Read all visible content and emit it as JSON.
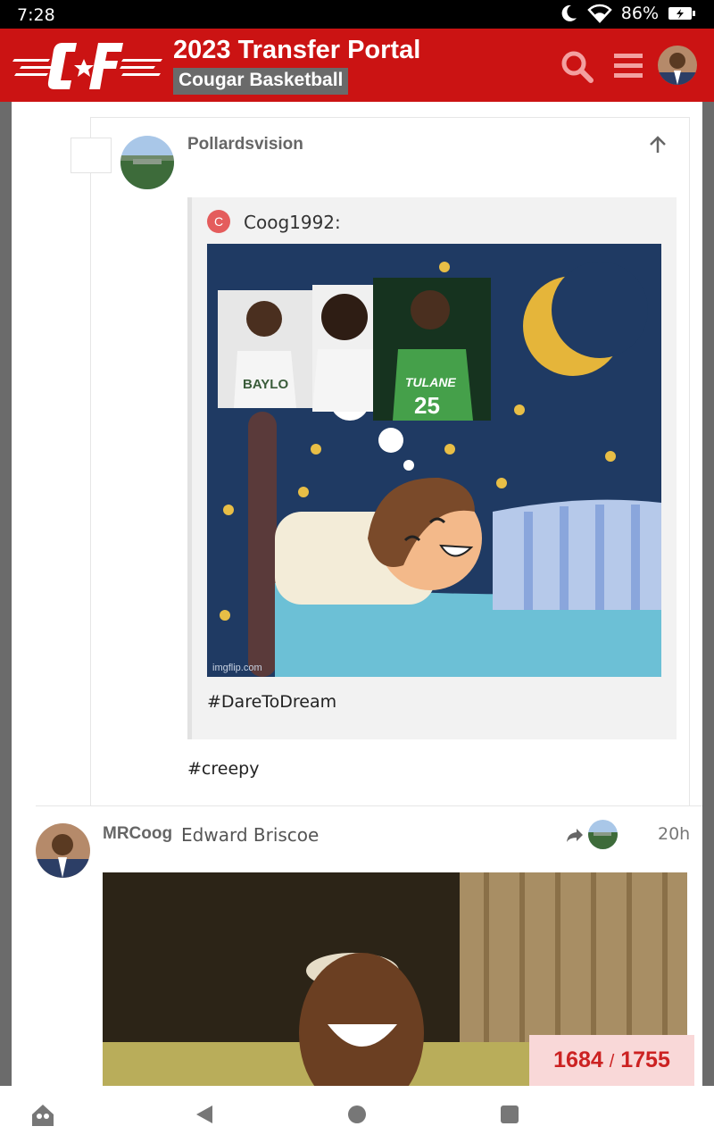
{
  "status_bar": {
    "time": "7:28",
    "battery": "86%"
  },
  "header": {
    "logo_text": "C★F",
    "title": "2023 Transfer Portal",
    "subtitle": "Cougar Basketball"
  },
  "post1": {
    "username": "Pollardsvision",
    "quote": {
      "avatar_letter": "C",
      "author": "Coog1992:",
      "image_watermark": "imgflip.com",
      "jersey_texts": [
        "BAYLO",
        "TULANE",
        "25"
      ],
      "text": "#DareToDream"
    },
    "text": "#creepy"
  },
  "post2": {
    "username": "MRCoog",
    "full_name": "Edward Briscoe",
    "time": "20h"
  },
  "progress": {
    "current": "1684",
    "separator": "/",
    "total": "1755"
  },
  "colors": {
    "brand_red": "#cb1313",
    "badge_gray": "#6a6a6a",
    "progress_bg": "#f9d8d8"
  }
}
